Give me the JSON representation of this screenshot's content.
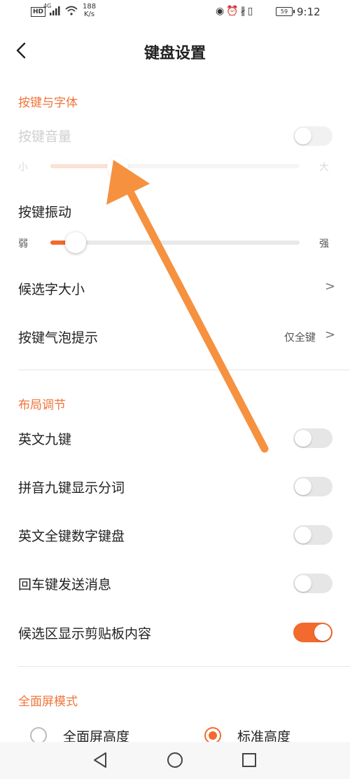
{
  "status_bar": {
    "hd": "HD",
    "network": "4G",
    "speed_value": "188",
    "speed_unit": "K/s",
    "battery": "59",
    "time": "9:12"
  },
  "header": {
    "title": "键盘设置",
    "back_icon": "chevron-left-icon"
  },
  "sections": {
    "keys_fonts": {
      "title": "按键与字体",
      "key_volume": {
        "label": "按键音量",
        "min_label": "小",
        "max_label": "大",
        "enabled": false,
        "level": 0.27
      },
      "key_vibration": {
        "label": "按键振动",
        "min_label": "弱",
        "max_label": "强",
        "level": 0.1
      },
      "candidate_size": {
        "label": "候选字大小"
      },
      "key_bubble": {
        "label": "按键气泡提示",
        "value": "仅全键"
      }
    },
    "layout": {
      "title": "布局调节",
      "items": [
        {
          "label": "英文九键",
          "on": false
        },
        {
          "label": "拼音九键显示分词",
          "on": false
        },
        {
          "label": "英文全键数字键盘",
          "on": false
        },
        {
          "label": "回车键发送消息",
          "on": false
        },
        {
          "label": "候选区显示剪贴板内容",
          "on": true
        }
      ]
    },
    "fullscreen": {
      "title": "全面屏模式",
      "options": [
        {
          "label": "全面屏高度",
          "selected": false
        },
        {
          "label": "标准高度",
          "selected": true
        }
      ]
    }
  },
  "navbar": {
    "back": "triangle-back-icon",
    "home": "circle-home-icon",
    "recents": "square-recents-icon"
  },
  "colors": {
    "accent": "#f26a2e",
    "section_title": "#f0753b",
    "annotation_arrow": "#f5913f"
  }
}
